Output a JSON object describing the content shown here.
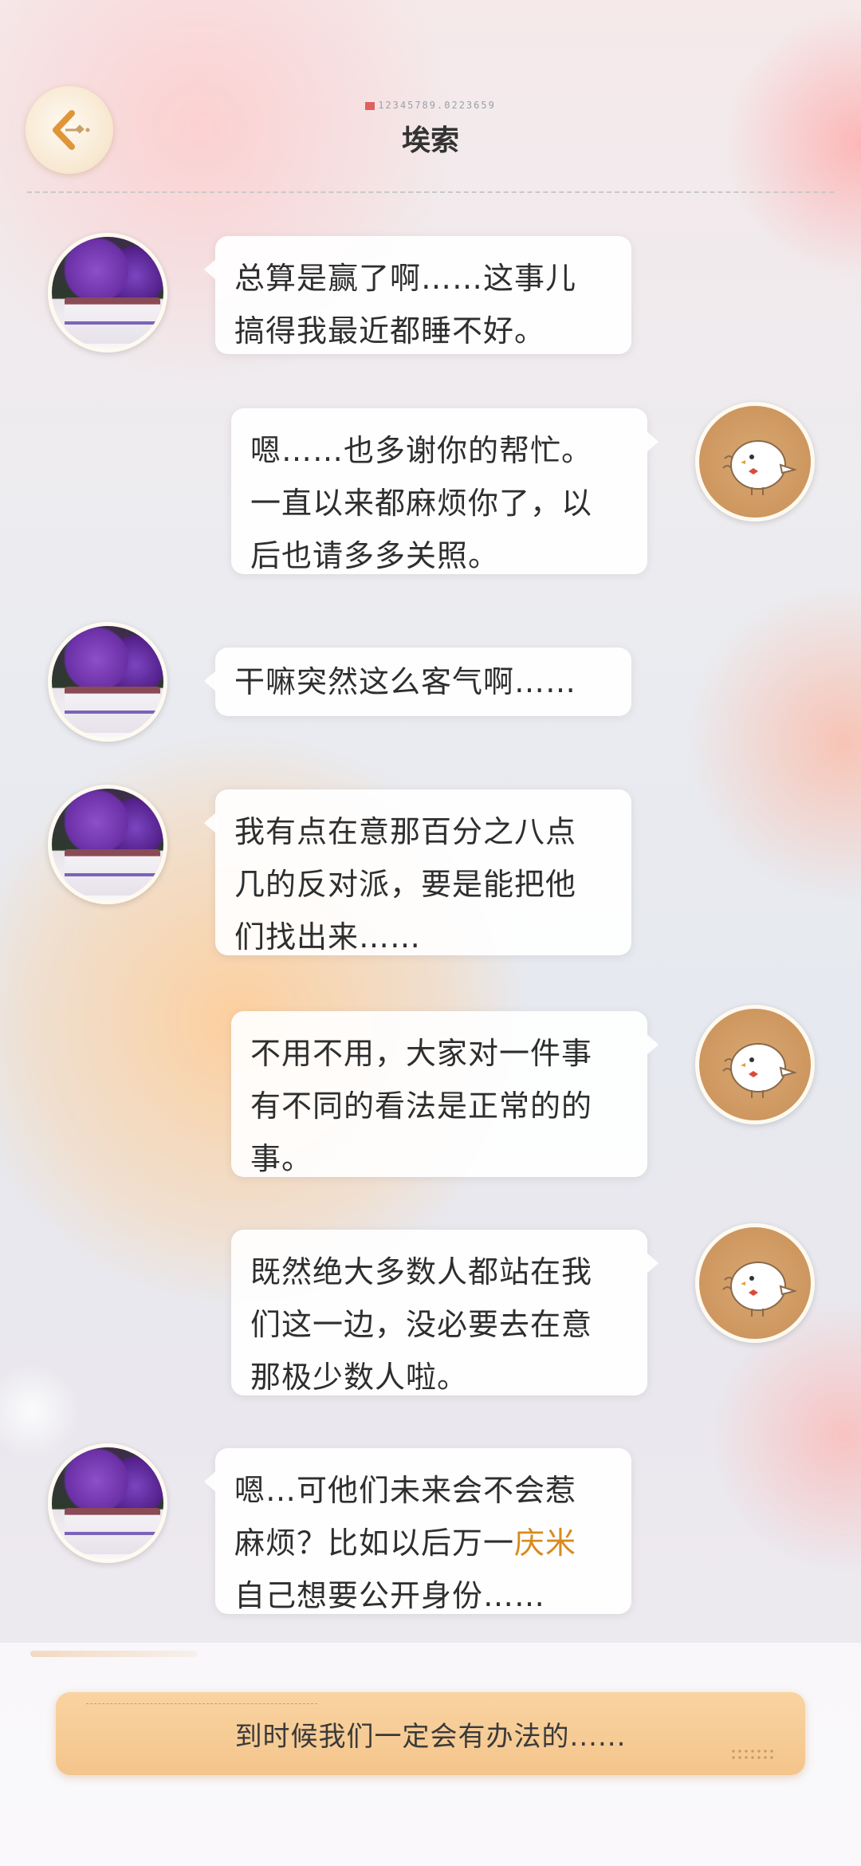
{
  "header": {
    "id_text": "12345789.0223659",
    "title": "埃索"
  },
  "messages": [
    {
      "sender": "other",
      "text": "总算是赢了啊……这事儿\n搞得我最近都睡不好。"
    },
    {
      "sender": "me",
      "text": "嗯……也多谢你的帮忙。\n一直以来都麻烦你了，以\n后也请多多关照。"
    },
    {
      "sender": "other",
      "text": "干嘛突然这么客气啊……"
    },
    {
      "sender": "other",
      "text": "我有点在意那百分之八点\n几的反对派，要是能把他\n们找出来……"
    },
    {
      "sender": "me",
      "text": "不用不用，大家对一件事\n有不同的看法是正常的的\n事。"
    },
    {
      "sender": "me",
      "text": "既然绝大多数人都站在我\n们这一边，没必要去在意\n那极少数人啦。"
    },
    {
      "sender": "other",
      "text_before": "嗯…可他们未来会不会惹\n麻烦？比如以后万一",
      "highlight": "庆米",
      "text_after": "\n自己想要公开身份……"
    }
  ],
  "reply_option": {
    "label": "到时候我们一定会有办法的......"
  },
  "colors": {
    "highlight": "#d88a1e",
    "choice_bg": "#f4c58c"
  },
  "icons": {
    "back": "back-arrow-icon",
    "my_avatar": "bird-avatar-icon"
  }
}
